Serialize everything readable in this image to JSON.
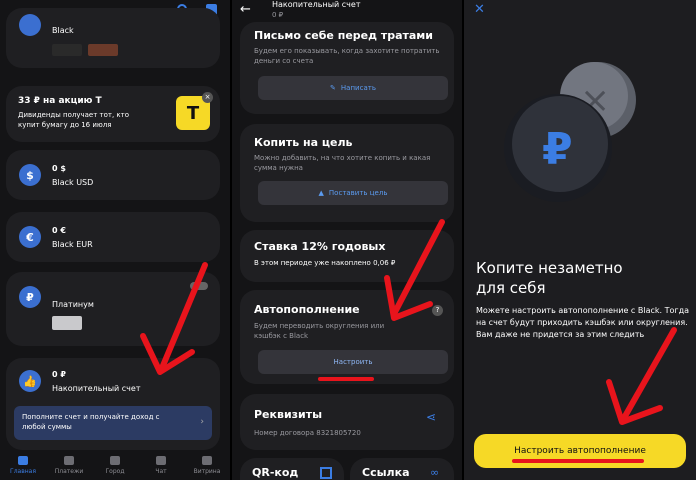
{
  "panel1": {
    "top_card": {
      "title": "Black"
    },
    "promo": {
      "title": "33 ₽ на акцию Т",
      "text": "Дивиденды получает тот, кто купит бумагу до 16 июля"
    },
    "accounts": [
      {
        "icon": "dollar-icon",
        "symbol": "$",
        "amount": "0 $",
        "name": "Black USD"
      },
      {
        "icon": "euro-icon",
        "symbol": "€",
        "amount": "0 €",
        "name": "Black EUR"
      },
      {
        "icon": "ruble-icon",
        "symbol": "₽",
        "amount": "",
        "name": "Платинум"
      },
      {
        "icon": "thumbs-up-icon",
        "symbol": "👍",
        "amount": "0 ₽",
        "name": "Накопительный счет"
      }
    ],
    "banner": {
      "text": "Пополните счет и получайте доход с любой суммы"
    },
    "tabs": [
      {
        "label": "Главная",
        "active": true
      },
      {
        "label": "Платежи",
        "active": false
      },
      {
        "label": "Город",
        "active": false
      },
      {
        "label": "Чат",
        "active": false
      },
      {
        "label": "Витрина",
        "active": false
      }
    ]
  },
  "panel2": {
    "header": {
      "title": "Накопительный счет",
      "amount": "0 ₽"
    },
    "letter": {
      "title": "Письмо себе перед тратами",
      "desc": "Будем его показывать, когда захотите потратить деньги со счета",
      "button": "Написать"
    },
    "goal": {
      "title": "Копить на цель",
      "desc": "Можно добавить, на что хотите копить и какая сумма нужна",
      "button": "Поставить цель"
    },
    "rate": {
      "title": "Ставка 12% годовых",
      "text": "В этом периоде уже накоплено 0,06 ₽"
    },
    "auto": {
      "title": "Автопополнение",
      "desc": "Будем переводить округления или кэшбэк с Black",
      "button": "Настроить"
    },
    "requisites": {
      "title": "Реквизиты",
      "text": "Номер договора 8321805720"
    },
    "bottom": {
      "qr": "QR-код",
      "link": "Ссылка"
    }
  },
  "panel3": {
    "title": "Копите незаметно для себя",
    "text": "Можете настроить автопополнение с Black. Тогда на счет будут приходить кэшбэк или округления. Вам даже не придется за этим следить",
    "button": "Настроить автопополнение"
  },
  "colors": {
    "accent": "#3b7de3",
    "yellow": "#f6d926",
    "arrow": "#e8141c"
  }
}
